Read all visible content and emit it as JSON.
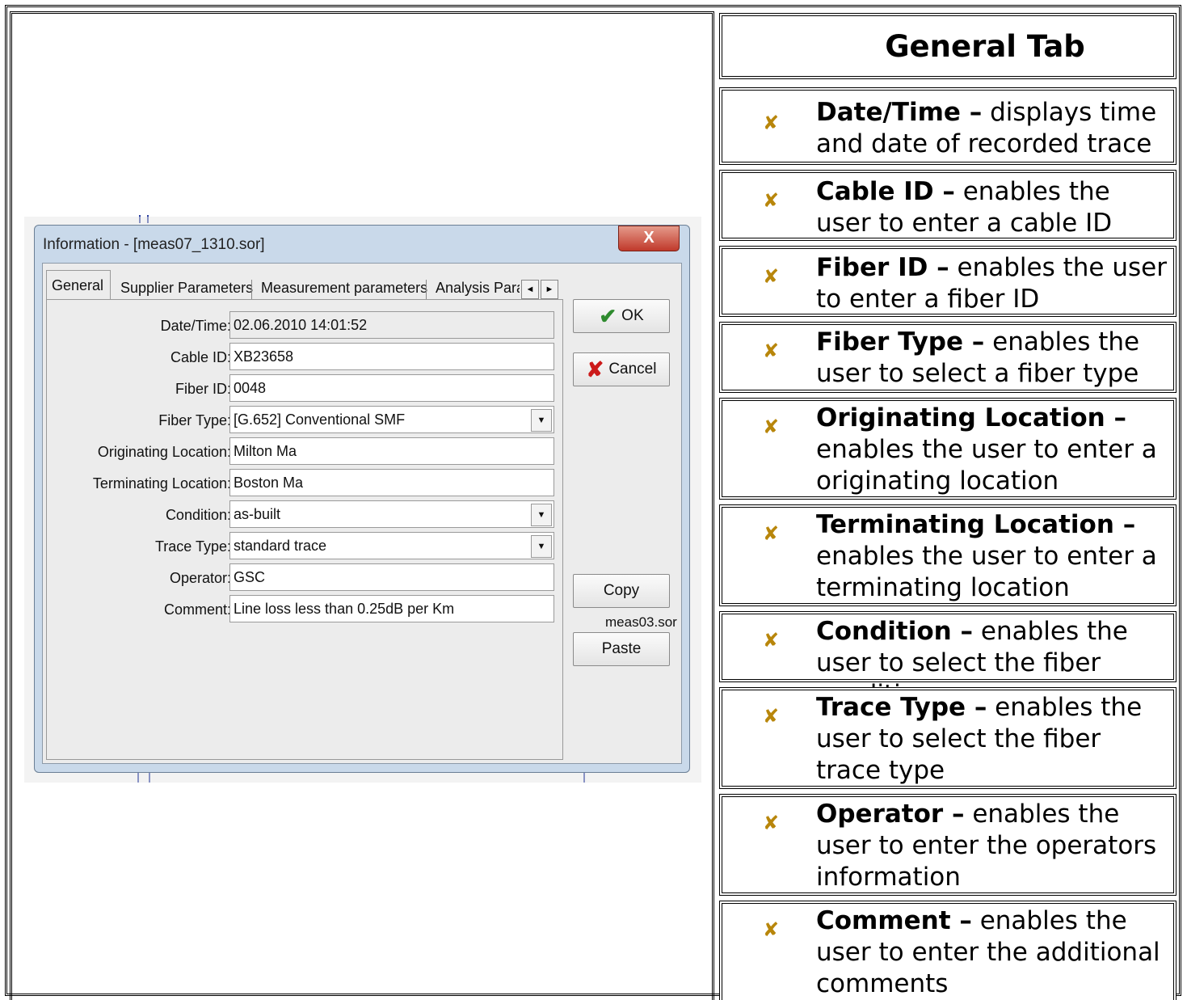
{
  "dialog": {
    "title": "Information - [meas07_1310.sor]",
    "close_label": "X",
    "tabs": [
      {
        "label": "General"
      },
      {
        "label": "Supplier Parameters"
      },
      {
        "label": "Measurement parameters"
      },
      {
        "label": "Analysis Para"
      }
    ],
    "tab_scroll_left": "◄",
    "tab_scroll_right": "►",
    "fields": {
      "datetime": {
        "label": "Date/Time:",
        "value": "02.06.2010   14:01:52"
      },
      "cable_id": {
        "label": "Cable ID:",
        "value": "XB23658"
      },
      "fiber_id": {
        "label": "Fiber ID:",
        "value": "0048"
      },
      "fiber_type": {
        "label": "Fiber Type:",
        "value": "[G.652] Conventional SMF"
      },
      "orig_loc": {
        "label": "Originating Location:",
        "value": "Milton Ma"
      },
      "term_loc": {
        "label": "Terminating Location:",
        "value": "Boston Ma"
      },
      "condition": {
        "label": "Condition:",
        "value": "as-built"
      },
      "trace_type": {
        "label": "Trace Type:",
        "value": "standard trace"
      },
      "operator": {
        "label": "Operator:",
        "value": "GSC"
      },
      "comment": {
        "label": "Comment:",
        "value": "Line loss less than 0.25dB per Km"
      }
    },
    "buttons": {
      "ok": "OK",
      "cancel": "Cancel",
      "copy": "Copy",
      "paste": "Paste"
    },
    "file_name": "meas03.sor"
  },
  "panel": {
    "header": "General Tab",
    "items": [
      {
        "term": "Date/Time –",
        "text": " displays time and date of recorded trace"
      },
      {
        "term": "Cable ID –",
        "text": " enables the user to enter a cable ID"
      },
      {
        "term": "Fiber ID –",
        "text": " enables the user to enter a fiber ID"
      },
      {
        "term": "Fiber Type –",
        "text": " enables the user to select a fiber type"
      },
      {
        "term": "Originating Location –",
        "text": " enables the user to enter a originating location"
      },
      {
        "term": "Terminating Location –",
        "text": " enables the user to enter a terminating location"
      },
      {
        "term": "Condition –",
        "text": " enables the user to select the fiber condition"
      },
      {
        "term": "Trace Type –",
        "text": " enables the user to select the fiber trace type"
      },
      {
        "term": "Operator –",
        "text": " enables the user to enter the operators information"
      },
      {
        "term": "Comment –",
        "text": " enables the user to enter the additional comments"
      }
    ]
  },
  "colors": {
    "bullet": "#b8860b",
    "dialog_frame": "#c9d9ea",
    "close_button": "#c0392b"
  },
  "icons": {
    "ok": "check-icon",
    "cancel": "x-icon",
    "bullet": "x-bullet-icon"
  }
}
